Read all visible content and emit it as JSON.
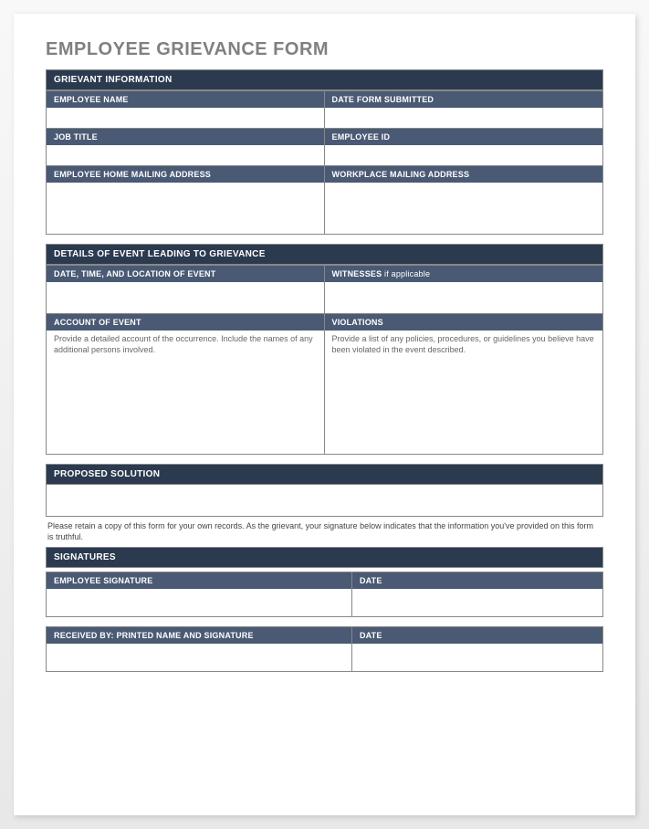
{
  "title": "EMPLOYEE GRIEVANCE FORM",
  "section1": {
    "header": "GRIEVANT INFORMATION",
    "employee_name_label": "EMPLOYEE NAME",
    "date_submitted_label": "DATE FORM SUBMITTED",
    "job_title_label": "JOB TITLE",
    "employee_id_label": "EMPLOYEE ID",
    "home_address_label": "EMPLOYEE HOME MAILING ADDRESS",
    "workplace_address_label": "WORKPLACE MAILING ADDRESS"
  },
  "section2": {
    "header": "DETAILS OF EVENT LEADING TO GRIEVANCE",
    "datetime_label": "DATE, TIME, AND LOCATION OF EVENT",
    "witnesses_label": "WITNESSES",
    "witnesses_suffix": " if applicable",
    "account_label": "ACCOUNT OF EVENT",
    "violations_label": "VIOLATIONS",
    "account_instruction": "Provide a detailed account of the occurrence. Include the names of any additional persons involved.",
    "violations_instruction": "Provide a list of any policies, procedures, or guidelines you believe have been violated in the event described."
  },
  "section3": {
    "header": "PROPOSED SOLUTION"
  },
  "disclaimer": "Please retain a copy of this form for your own records.  As the grievant, your signature below indicates that the information you've provided on this form is truthful.",
  "section4": {
    "header": "SIGNATURES",
    "employee_sig_label": "EMPLOYEE SIGNATURE",
    "date_label": "DATE",
    "received_by_label": "RECEIVED BY: PRINTED NAME AND SIGNATURE",
    "date2_label": "DATE"
  }
}
